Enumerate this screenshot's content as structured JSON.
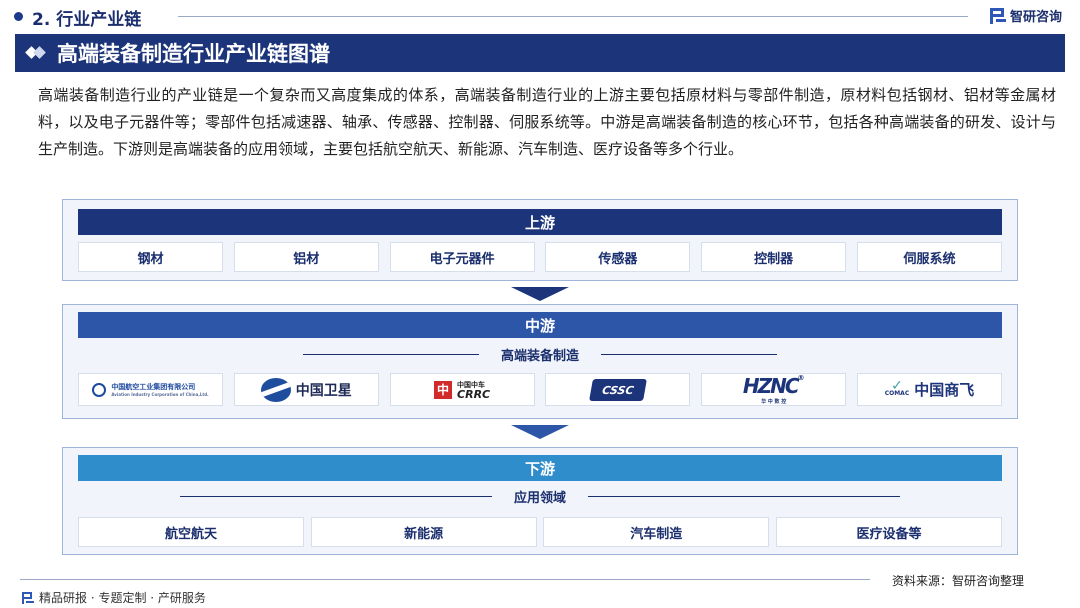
{
  "header": {
    "section": "2. 行业产业链",
    "brand": "智研咨询"
  },
  "title": "高端装备制造行业产业链图谱",
  "intro": "高端装备制造行业的产业链是一个复杂而又高度集成的体系，高端装备制造行业的上游主要包括原材料与零部件制造，原材料包括钢材、铝材等金属材料，以及电子元器件等；零部件包括减速器、轴承、传感器、控制器、伺服系统等。中游是高端装备制造的核心环节，包括各种高端装备的研发、设计与生产制造。下游则是高端装备的应用领域，主要包括航空航天、新能源、汽车制造、医疗设备等多个行业。",
  "upstream": {
    "label": "上游",
    "items": [
      "钢材",
      "铝材",
      "电子元器件",
      "传感器",
      "控制器",
      "伺服系统"
    ]
  },
  "midstream": {
    "label": "中游",
    "subheading": "高端装备制造",
    "logos": {
      "avic": {
        "cn": "中国航空工业集团有限公司",
        "en": "Aviation Industry Corporation of China,Ltd."
      },
      "satellite": {
        "text": "中国卫星"
      },
      "crrc": {
        "mark": "中",
        "cn": "中国中车",
        "en": "CRRC"
      },
      "cssc": {
        "text": "CSSC"
      },
      "hz": {
        "mark": "HZNC",
        "reg": "®",
        "sub": "华 中 数 控"
      },
      "comac": {
        "en": "COMAC",
        "cn": "中国商飞"
      }
    }
  },
  "downstream": {
    "label": "下游",
    "subheading": "应用领域",
    "items": [
      "航空航天",
      "新能源",
      "汽车制造",
      "医疗设备等"
    ]
  },
  "footer": {
    "source": "资料来源：智研咨询整理",
    "services": "精品研报 · 专题定制 · 产研服务"
  },
  "colors": {
    "navy": "#1c3479",
    "mid_blue": "#2e56a8",
    "light_blue": "#2f8dcc",
    "panel_bg": "#f1f4fa"
  }
}
